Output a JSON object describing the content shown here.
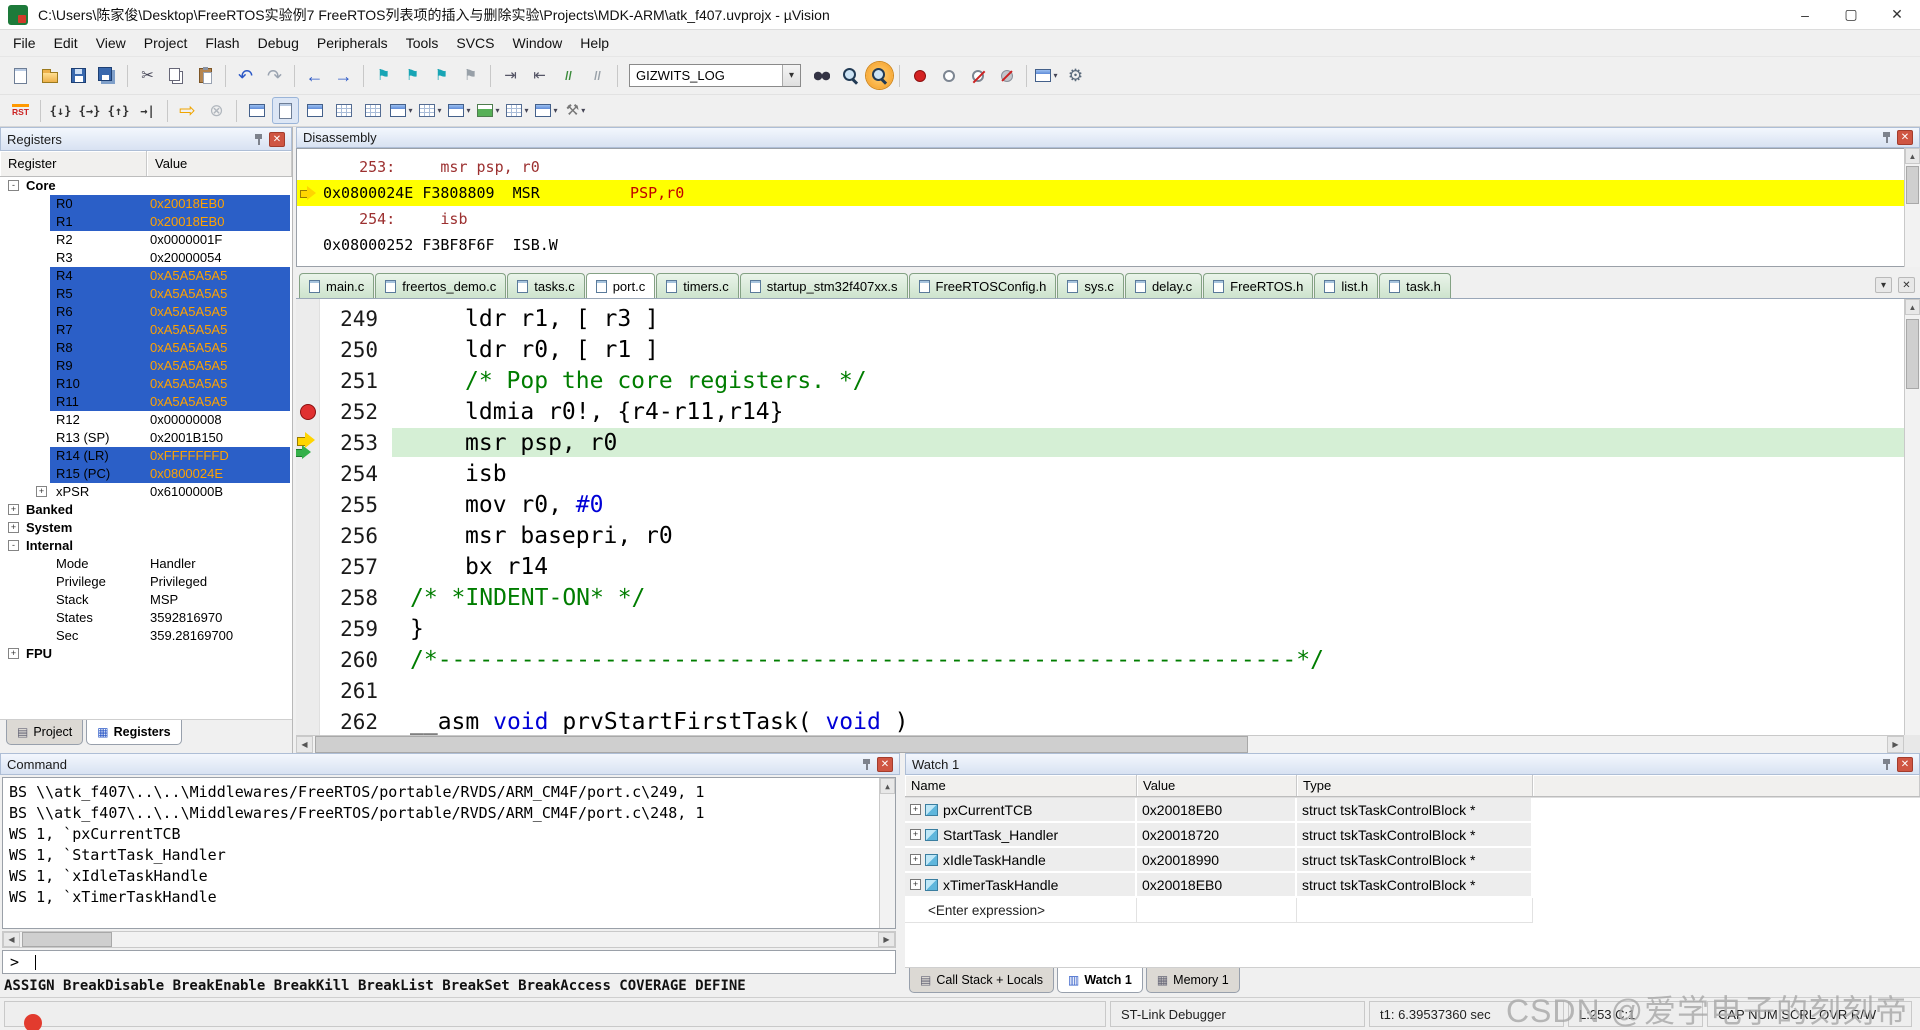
{
  "icons": {
    "close": "✕",
    "min": "–",
    "max": "▢",
    "dropdown": "▾",
    "left": "◀",
    "right": "▶",
    "up": "▲",
    "down": "▼",
    "project_tab": "▤",
    "registers_tab": "▦",
    "callstack_tab": "▤",
    "watch_tab": "▥",
    "memory_tab": "▦",
    "file_page": "▯"
  },
  "window": {
    "title": "C:\\Users\\陈家俊\\Desktop\\FreeRTOS实验例7 FreeRTOS列表项的插入与删除实验\\Projects\\MDK-ARM\\atk_f407.uvprojx - µVision"
  },
  "menu": [
    "File",
    "Edit",
    "View",
    "Project",
    "Flash",
    "Debug",
    "Peripherals",
    "Tools",
    "SVCS",
    "Window",
    "Help"
  ],
  "toolbar_main": {
    "combo_value": "GIZWITS_LOG",
    "items": [
      {
        "shape": "page",
        "name": "new-file-icon"
      },
      {
        "shape": "folder",
        "name": "open-file-icon"
      },
      {
        "shape": "floppy",
        "name": "save-icon"
      },
      {
        "shape": "floppy-all",
        "name": "save-all-icon"
      },
      {
        "type": "sep"
      },
      {
        "glyph": "✂",
        "name": "cut-icon",
        "color": "#445"
      },
      {
        "shape": "copy",
        "name": "copy-icon"
      },
      {
        "shape": "paste",
        "name": "paste-icon"
      },
      {
        "type": "sep"
      },
      {
        "glyph": "↶",
        "name": "undo-icon",
        "color": "#2a57c6",
        "size": 18
      },
      {
        "glyph": "↷",
        "name": "redo-icon",
        "color": "#9aa3b0",
        "size": 18
      },
      {
        "type": "sep"
      },
      {
        "glyph": "←",
        "name": "nav-back-icon",
        "color": "#2a57c6",
        "size": 18
      },
      {
        "glyph": "→",
        "name": "nav-forward-icon",
        "color": "#2a57c6",
        "size": 18
      },
      {
        "type": "sep"
      },
      {
        "glyph": "⚑",
        "name": "bookmark-toggle-icon",
        "color": "#18a5b5"
      },
      {
        "glyph": "⚑",
        "name": "bookmark-prev-icon",
        "color": "#18a5b5"
      },
      {
        "glyph": "⚑",
        "name": "bookmark-next-icon",
        "color": "#18a5b5"
      },
      {
        "glyph": "⚑",
        "name": "bookmark-clear-icon",
        "color": "#98a0a8"
      },
      {
        "type": "sep"
      },
      {
        "glyph": "⇥",
        "name": "indent-icon",
        "color": "#556"
      },
      {
        "glyph": "⇤",
        "name": "unindent-icon",
        "color": "#556"
      },
      {
        "glyph": "//",
        "name": "comment-icon",
        "color": "#3a8a3a",
        "cls": "small"
      },
      {
        "glyph": "//",
        "name": "uncomment-icon",
        "color": "#98a0a8",
        "cls": "small"
      },
      {
        "type": "sep"
      },
      {
        "type": "combo"
      },
      {
        "shape": "binoc",
        "name": "find-in-files-icon"
      },
      {
        "shape": "mag",
        "name": "find-next-icon"
      },
      {
        "shape": "mag",
        "name": "find-icon",
        "active": true
      },
      {
        "type": "sep"
      },
      {
        "shape": "dot-red",
        "name": "insert-breakpoint-icon"
      },
      {
        "shape": "dot-hollow",
        "name": "enable-breakpoint-icon"
      },
      {
        "shape": "dot-slash",
        "name": "kill-breakpoints-icon"
      },
      {
        "shape": "dot-gray",
        "name": "disable-breakpoints-icon"
      },
      {
        "type": "sep"
      },
      {
        "shape": "window",
        "name": "debug-windows-icon",
        "dropdown": true
      },
      {
        "glyph": "⚙",
        "name": "configure-icon",
        "color": "#5b6b7c",
        "size": 17
      }
    ]
  },
  "toolbar_debug": {
    "items": [
      {
        "glyph": "RST",
        "name": "reset-icon",
        "cls": "rst"
      },
      {
        "type": "sep"
      },
      {
        "glyph": "{↓}",
        "name": "step-into-icon",
        "color": "#333",
        "cls": "step"
      },
      {
        "glyph": "{→}",
        "name": "step-over-icon",
        "color": "#333",
        "cls": "step"
      },
      {
        "glyph": "{↑}",
        "name": "step-out-icon",
        "color": "#333",
        "cls": "step"
      },
      {
        "glyph": "→|",
        "name": "run-to-cursor-icon",
        "color": "#333",
        "cls": "step"
      },
      {
        "type": "sep"
      },
      {
        "glyph": "⇨",
        "name": "run-icon",
        "color": "#f0a500",
        "size": 20
      },
      {
        "glyph": "⊗",
        "name": "stop-icon",
        "color": "#b0b6bd",
        "size": 17
      },
      {
        "type": "sep"
      },
      {
        "shape": "window",
        "name": "command-window-icon"
      },
      {
        "shape": "page",
        "name": "disassembly-window-icon",
        "pressed": true
      },
      {
        "shape": "window",
        "name": "symbol-window-icon"
      },
      {
        "shape": "grid",
        "name": "registers-window-icon"
      },
      {
        "shape": "grid",
        "name": "callstack-window-icon"
      },
      {
        "shape": "window",
        "name": "watch-window-icon",
        "dropdown": true
      },
      {
        "shape": "grid",
        "name": "memory-window-icon",
        "dropdown": true
      },
      {
        "shape": "window",
        "name": "serial-window-icon",
        "dropdown": true
      },
      {
        "shape": "chart",
        "name": "analysis-window-icon",
        "dropdown": true
      },
      {
        "shape": "grid",
        "name": "trace-window-icon",
        "dropdown": true
      },
      {
        "shape": "window",
        "name": "system-viewer-icon",
        "dropdown": true
      },
      {
        "glyph": "⚒",
        "name": "toolbox-icon",
        "color": "#777",
        "dropdown": true
      }
    ]
  },
  "registers": {
    "title": "Registers",
    "columns": [
      "Register",
      "Value"
    ],
    "rows": [
      {
        "level": 0,
        "exp": "-",
        "name": "Core",
        "value": ""
      },
      {
        "level": 1,
        "name": "R0",
        "value": "0x20018EB0",
        "hl": true
      },
      {
        "level": 1,
        "name": "R1",
        "value": "0x20018EB0",
        "hl": true
      },
      {
        "level": 1,
        "name": "R2",
        "value": "0x0000001F"
      },
      {
        "level": 1,
        "name": "R3",
        "value": "0x20000054"
      },
      {
        "level": 1,
        "name": "R4",
        "value": "0xA5A5A5A5",
        "hl": true
      },
      {
        "level": 1,
        "name": "R5",
        "value": "0xA5A5A5A5",
        "hl": true
      },
      {
        "level": 1,
        "name": "R6",
        "value": "0xA5A5A5A5",
        "hl": true
      },
      {
        "level": 1,
        "name": "R7",
        "value": "0xA5A5A5A5",
        "hl": true
      },
      {
        "level": 1,
        "name": "R8",
        "value": "0xA5A5A5A5",
        "hl": true
      },
      {
        "level": 1,
        "name": "R9",
        "value": "0xA5A5A5A5",
        "hl": true
      },
      {
        "level": 1,
        "name": "R10",
        "value": "0xA5A5A5A5",
        "hl": true
      },
      {
        "level": 1,
        "name": "R11",
        "value": "0xA5A5A5A5",
        "hl": true
      },
      {
        "level": 1,
        "name": "R12",
        "value": "0x00000008"
      },
      {
        "level": 1,
        "name": "R13 (SP)",
        "value": "0x2001B150"
      },
      {
        "level": 1,
        "name": "R14 (LR)",
        "value": "0xFFFFFFFD",
        "hl": true
      },
      {
        "level": 1,
        "name": "R15 (PC)",
        "value": "0x0800024E",
        "hl": true
      },
      {
        "level": 1,
        "exp": "+",
        "name": "xPSR",
        "value": "0x6100000B"
      },
      {
        "level": 0,
        "exp": "+",
        "name": "Banked",
        "value": ""
      },
      {
        "level": 0,
        "exp": "+",
        "name": "System",
        "value": ""
      },
      {
        "level": 0,
        "exp": "-",
        "name": "Internal",
        "value": ""
      },
      {
        "level": 1,
        "name": "Mode",
        "value": "Handler"
      },
      {
        "level": 1,
        "name": "Privilege",
        "value": "Privileged"
      },
      {
        "level": 1,
        "name": "Stack",
        "value": "MSP"
      },
      {
        "level": 1,
        "name": "States",
        "value": "3592816970"
      },
      {
        "level": 1,
        "name": "Sec",
        "value": "359.28169700"
      },
      {
        "level": 0,
        "exp": "+",
        "name": "FPU",
        "value": ""
      }
    ],
    "bottom_tabs": [
      {
        "label": "Project",
        "active": false
      },
      {
        "label": "Registers",
        "active": true
      }
    ]
  },
  "disassembly": {
    "title": "Disassembly",
    "lines": [
      {
        "seg": [
          [
            "    253:     msr psp, r0",
            "s"
          ]
        ]
      },
      {
        "cur": true,
        "seg": [
          [
            "0x0800024E F3808809  MSR          ",
            "p"
          ],
          [
            "PSP,r0",
            "r"
          ]
        ]
      },
      {
        "seg": [
          [
            "    254:     isb",
            "s"
          ]
        ]
      },
      {
        "seg": [
          [
            "0x08000252 F3BF8F6F  ISB.W",
            "p"
          ]
        ]
      }
    ]
  },
  "editor": {
    "tabs": [
      {
        "label": "main.c"
      },
      {
        "label": "freertos_demo.c"
      },
      {
        "label": "tasks.c"
      },
      {
        "label": "port.c",
        "active": true
      },
      {
        "label": "timers.c"
      },
      {
        "label": "startup_stm32f407xx.s"
      },
      {
        "label": "FreeRTOSConfig.h"
      },
      {
        "label": "sys.c"
      },
      {
        "label": "delay.c"
      },
      {
        "label": "FreeRTOS.h"
      },
      {
        "label": "list.h"
      },
      {
        "label": "task.h"
      }
    ],
    "lines": [
      {
        "no": "249",
        "ind": 1,
        "seg": [
          [
            "ldr r1, [ r3 ]",
            "p"
          ]
        ]
      },
      {
        "no": "250",
        "ind": 1,
        "seg": [
          [
            "ldr r0, [ r1 ]",
            "p"
          ]
        ]
      },
      {
        "no": "251",
        "ind": 1,
        "seg": [
          [
            "/* Pop the core registers. */",
            "c"
          ]
        ]
      },
      {
        "no": "252",
        "ind": 1,
        "bp": true,
        "seg": [
          [
            "ldmia r0!, {r4-r11,r14}",
            "p"
          ]
        ]
      },
      {
        "no": "253",
        "ind": 1,
        "cur": true,
        "arrow": true,
        "seg": [
          [
            "msr psp, r0",
            "p"
          ]
        ]
      },
      {
        "no": "254",
        "ind": 1,
        "seg": [
          [
            "isb",
            "p"
          ]
        ]
      },
      {
        "no": "255",
        "ind": 1,
        "seg": [
          [
            "mov r0, ",
            "p"
          ],
          [
            "#0",
            "n"
          ]
        ]
      },
      {
        "no": "256",
        "ind": 1,
        "seg": [
          [
            "msr basepri, r0",
            "p"
          ]
        ]
      },
      {
        "no": "257",
        "ind": 1,
        "seg": [
          [
            "bx r14",
            "p"
          ]
        ]
      },
      {
        "no": "258",
        "ind": 0,
        "seg": [
          [
            "/* *INDENT-ON* */",
            "c"
          ]
        ]
      },
      {
        "no": "259",
        "ind": 0,
        "seg": [
          [
            "}",
            "p"
          ]
        ]
      },
      {
        "no": "260",
        "ind": 0,
        "seg": [
          [
            "/*--------------------------------------------------------------*/",
            "c"
          ]
        ]
      },
      {
        "no": "261",
        "ind": 0,
        "seg": []
      },
      {
        "no": "262",
        "ind": 0,
        "seg": [
          [
            "__asm ",
            "p"
          ],
          [
            "void",
            "k"
          ],
          [
            " prvStartFirstTask( ",
            "p"
          ],
          [
            "void",
            "k"
          ],
          [
            " )",
            "p"
          ]
        ]
      }
    ]
  },
  "command": {
    "title": "Command",
    "lines": [
      "BS \\\\atk_f407\\..\\..\\Middlewares/FreeRTOS/portable/RVDS/ARM_CM4F/port.c\\249, 1",
      "BS \\\\atk_f407\\..\\..\\Middlewares/FreeRTOS/portable/RVDS/ARM_CM4F/port.c\\248, 1",
      "WS 1, `pxCurrentTCB",
      "WS 1, `StartTask_Handler",
      "WS 1, `xIdleTaskHandle",
      "WS 1, `xTimerTaskHandle"
    ],
    "prompt": ">",
    "help_line": "ASSIGN BreakDisable BreakEnable BreakKill BreakList BreakSet BreakAccess COVERAGE DEFINE"
  },
  "watch": {
    "title": "Watch 1",
    "columns": [
      "Name",
      "Value",
      "Type"
    ],
    "rows": [
      {
        "name": "pxCurrentTCB",
        "value": "0x20018EB0",
        "type": "struct tskTaskControlBlock *"
      },
      {
        "name": "StartTask_Handler",
        "value": "0x20018720",
        "type": "struct tskTaskControlBlock *"
      },
      {
        "name": "xIdleTaskHandle",
        "value": "0x20018990",
        "type": "struct tskTaskControlBlock *"
      },
      {
        "name": "xTimerTaskHandle",
        "value": "0x20018EB0",
        "type": "struct tskTaskControlBlock *"
      }
    ],
    "placeholder_row": "<Enter expression>",
    "tabs": [
      {
        "label": "Call Stack + Locals",
        "icon": "callstack_tab",
        "active": false
      },
      {
        "label": "Watch 1",
        "icon": "watch_tab",
        "active": true
      },
      {
        "label": "Memory 1",
        "icon": "memory_tab",
        "active": false
      }
    ]
  },
  "status_bar": {
    "items": [
      "ST-Link Debugger",
      "t1: 6.39537360 sec",
      "L:253 C:1",
      "CAP NUM SCRL OVR R/W"
    ]
  },
  "watermark": {
    "text": "CSDN @爱学电子的刻刻帝"
  },
  "colors": {
    "register_highlight": "#2b5fc7",
    "register_value_orange": "#ffa200",
    "current_line_green": "#d5efd5",
    "disasm_current_yellow": "#ffff00",
    "breakpoint_red": "#e03030",
    "tab_green": "#cde3cd"
  }
}
